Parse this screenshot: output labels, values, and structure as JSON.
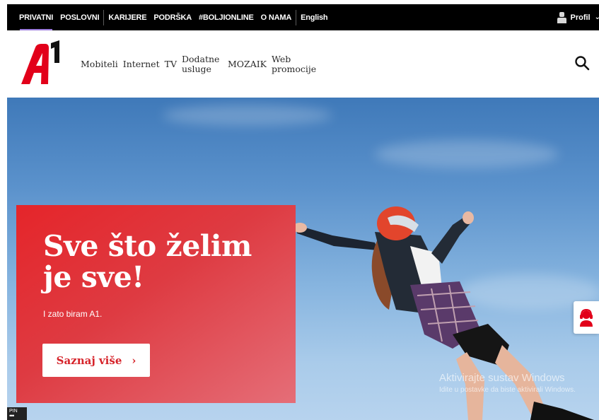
{
  "topbar": {
    "items": [
      {
        "label": "PRIVATNI"
      },
      {
        "label": "POSLOVNI"
      },
      {
        "label": "KARIJERE"
      },
      {
        "label": "PODRŠKA"
      },
      {
        "label": "#BOLJIONLINE"
      },
      {
        "label": "O NAMA"
      },
      {
        "label": "English"
      }
    ],
    "profile_label": "Profil",
    "profile_icon": "person-icon",
    "active_color": "#9b7bdc"
  },
  "header": {
    "logo_icon": "a1-logo",
    "brand_color": "#e2001a",
    "nav": [
      {
        "label": "Mobiteli"
      },
      {
        "label": "Internet"
      },
      {
        "label": "TV"
      },
      {
        "label": "Dodatne usluge"
      },
      {
        "label": "MOZAIK"
      },
      {
        "label": "Web promocije"
      }
    ],
    "search_icon": "search-icon"
  },
  "hero": {
    "headline": "Sve što želim je sve!",
    "subline": "I zato biram A1.",
    "cta_label": "Saznaj više",
    "cta_icon": "chevron-right-icon",
    "support_icon": "headset-agent-icon"
  },
  "watermark": {
    "line1": "Aktivirajte sustav Windows",
    "line2": "Idite u postavke da biste aktivirali Windows."
  },
  "pin": {
    "label": "PIN",
    "dots": "•••"
  }
}
